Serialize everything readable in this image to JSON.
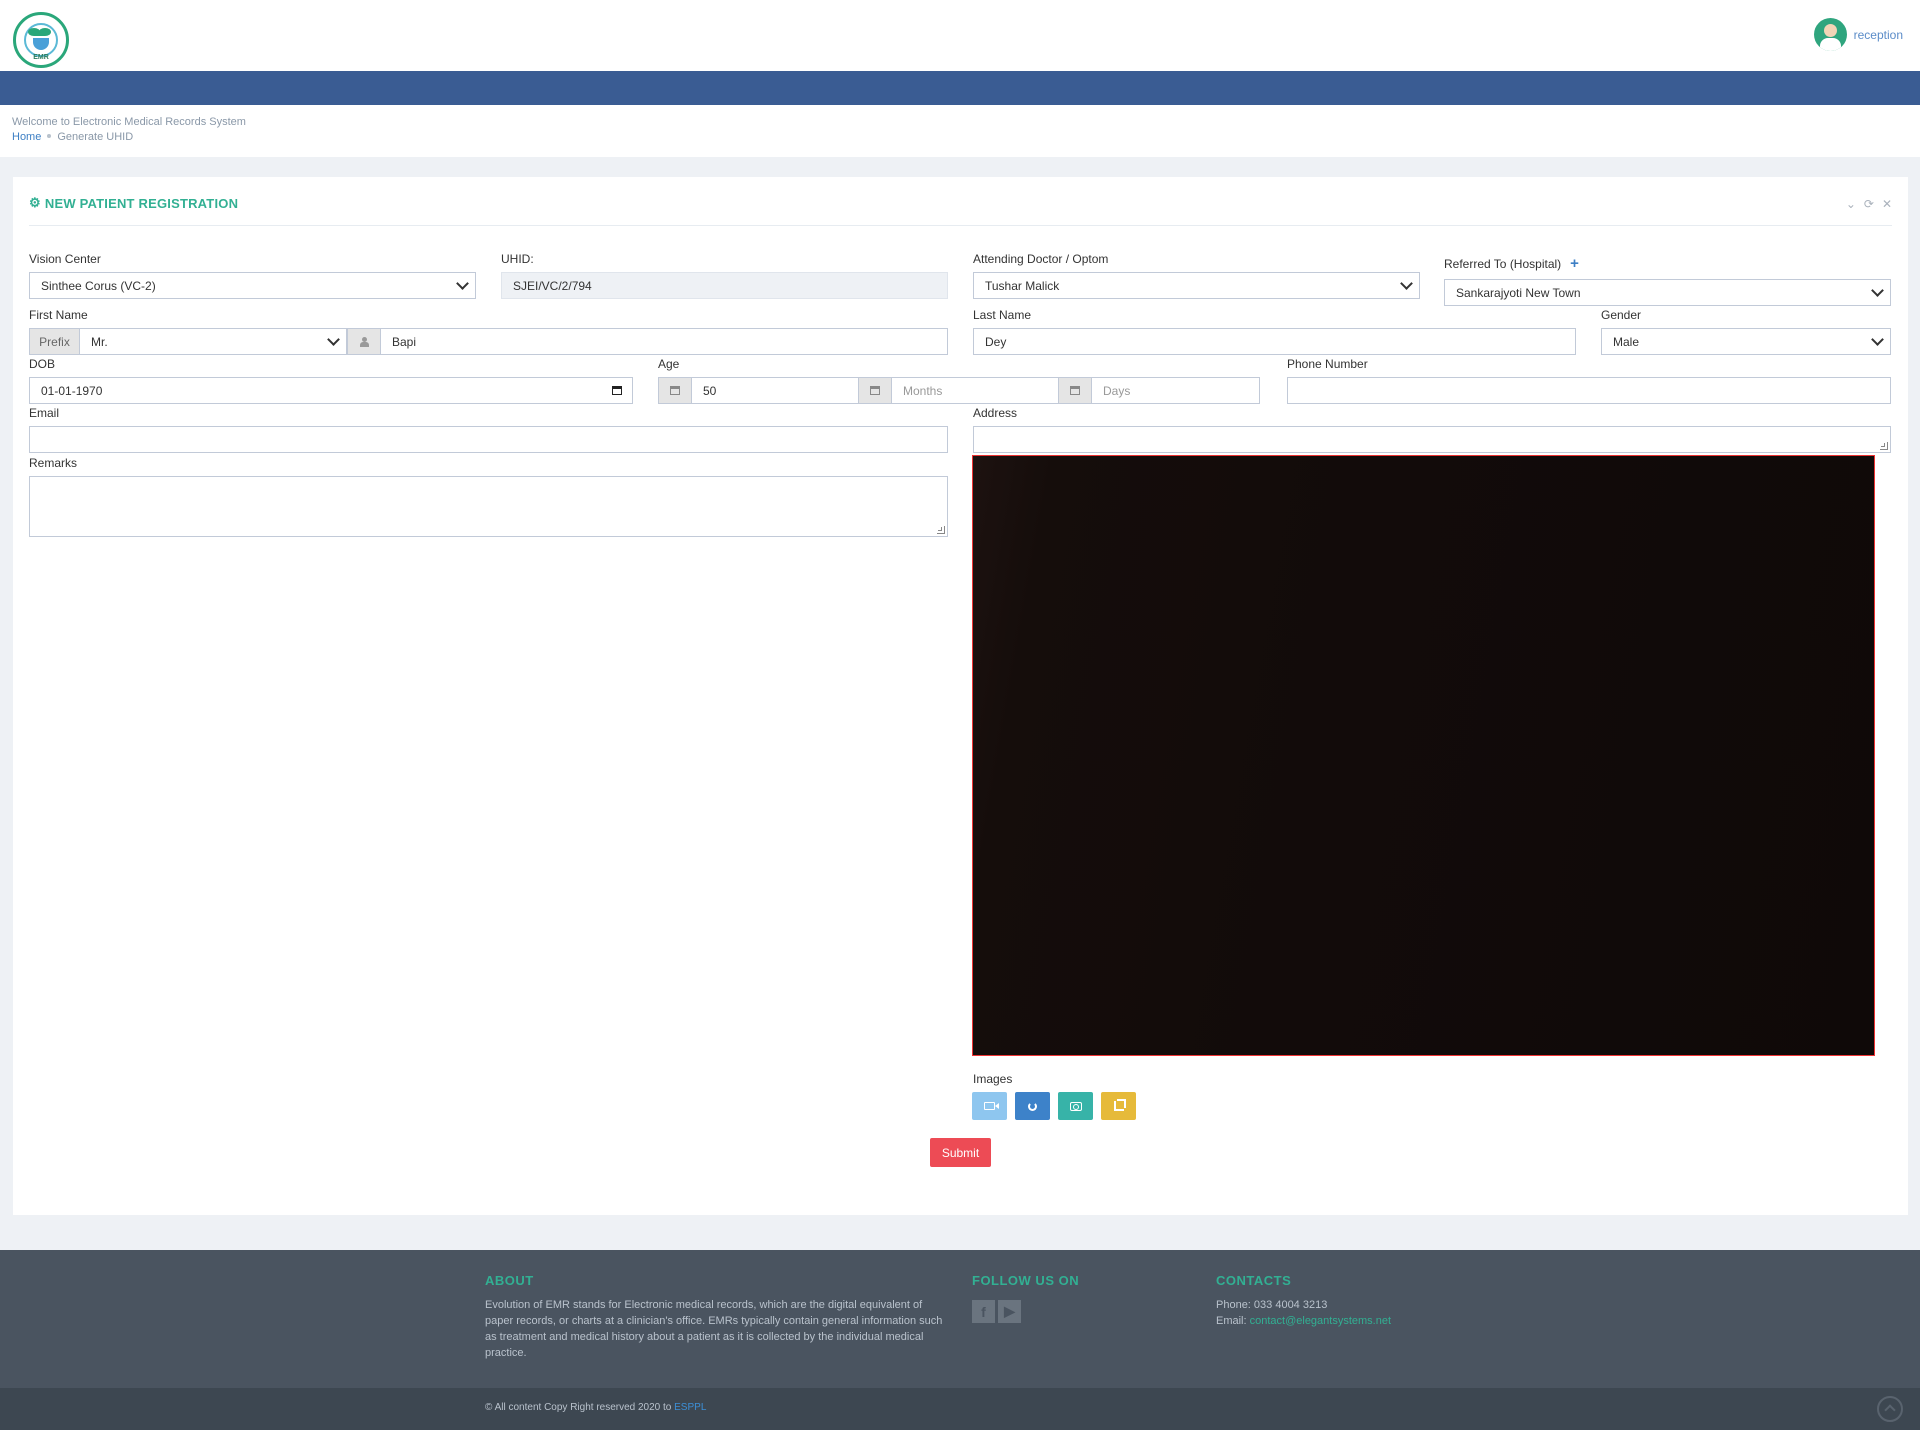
{
  "header": {
    "user_name": "reception",
    "logo_text": "EMR"
  },
  "page": {
    "welcome": "Welcome to Electronic Medical Records System",
    "breadcrumb": {
      "home": "Home",
      "current": "Generate UHID"
    }
  },
  "panel": {
    "title": "NEW PATIENT REGISTRATION"
  },
  "form": {
    "vision_center": {
      "label": "Vision Center",
      "value": "Sinthee Corus (VC-2)"
    },
    "uhid": {
      "label": "UHID:",
      "value": "SJEI/VC/2/794"
    },
    "doctor": {
      "label": "Attending Doctor / Optom",
      "value": "Tushar Malick"
    },
    "referred": {
      "label": "Referred To (Hospital)",
      "value": "Sankarajyoti New Town"
    },
    "first_name": {
      "label": "First Name",
      "prefix_addon": "Prefix",
      "prefix_value": "Mr.",
      "value": "Bapi"
    },
    "last_name": {
      "label": "Last Name",
      "value": "Dey"
    },
    "gender": {
      "label": "Gender",
      "value": "Male"
    },
    "dob": {
      "label": "DOB",
      "value": "01-01-1970"
    },
    "age": {
      "label": "Age",
      "years": "50",
      "months_placeholder": "Months",
      "days_placeholder": "Days"
    },
    "phone": {
      "label": "Phone Number",
      "value": ""
    },
    "email": {
      "label": "Email",
      "value": ""
    },
    "address": {
      "label": "Address",
      "value": ""
    },
    "remarks": {
      "label": "Remarks",
      "value": ""
    },
    "images": {
      "label": "Images"
    },
    "submit_label": "Submit"
  },
  "footer": {
    "about_title": "ABOUT",
    "about_text": "Evolution of EMR stands for Electronic medical records, which are the digital equivalent of paper records, or charts at a clinician's office. EMRs typically contain general information such as treatment and medical history about a patient as it is collected by the individual medical practice.",
    "follow_title": "FOLLOW US ON",
    "contacts_title": "CONTACTS",
    "phone": "Phone: 033 4004 3213",
    "email_label": "Email: ",
    "email": "contact@elegantsystems.net",
    "copyright": "© All content Copy Right reserved 2020 to ",
    "company": "ESPPL"
  },
  "colors": {
    "accent": "#32b093",
    "navbar": "#3a5c93",
    "submit": "#ed4b55",
    "video_border": "#ee3333"
  },
  "icons": [
    "cogs-icon",
    "chevron-down-icon",
    "refresh-icon",
    "close-icon",
    "plus-icon",
    "user-icon",
    "calendar-icon",
    "video-icon",
    "camera-icon",
    "crop-icon",
    "facebook-icon",
    "youtube-icon",
    "arrow-up-icon"
  ]
}
